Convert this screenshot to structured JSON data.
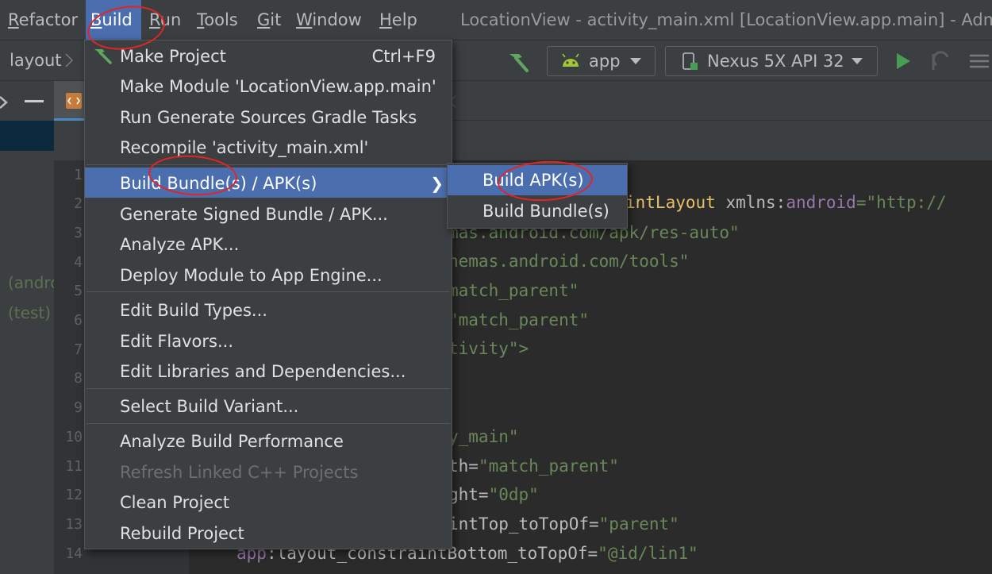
{
  "menubar": {
    "items": [
      {
        "label": "Refactor",
        "key": "R",
        "rest": "efactor"
      },
      {
        "label": "Build",
        "key": "B",
        "rest": "uild"
      },
      {
        "label": "Run",
        "key": "R",
        "rest": "un"
      },
      {
        "label": "Tools",
        "key": "T",
        "rest": "ools"
      },
      {
        "label": "Git",
        "key": "G",
        "rest": "it"
      },
      {
        "label": "Window",
        "key": "W",
        "rest": "indow"
      },
      {
        "label": "Help",
        "key": "H",
        "rest": "elp"
      }
    ],
    "window_title": "LocationView - activity_main.xml [LocationView.app.main] - Admin"
  },
  "toolbar": {
    "breadcrumb": "layout",
    "run_config": "app",
    "device": "Nexus 5X API 32"
  },
  "sidebar": {
    "labels": [
      "(andro",
      "(test)"
    ]
  },
  "editor": {
    "line_numbers": [
      "1",
      "2",
      "3",
      "4",
      "5",
      "6",
      "7",
      "8",
      "9",
      "10",
      "11",
      "12",
      "13",
      "14"
    ],
    "code": {
      "l2_tag": "intLayout",
      "l2_attr": " xmlns:",
      "l2_ns": "android",
      "l2_str": "=\"http://",
      "l3": "mas.android.com/apk/res-auto\"",
      "l4": "nemas.android.com/tools\"",
      "l5": "match_parent\"",
      "l6": "\"match_parent\"",
      "l7": "tivity\">",
      "l10": "y_main\"",
      "l11_attr": "th=",
      "l11_str": "\"match_parent\"",
      "l12_attr": "ght=",
      "l12_str": "\"0dp\"",
      "l13_attr": "intTop_toTopOf=",
      "l13_str": "\"parent\"",
      "l14_ns": "app",
      "l14_attr": ":layout_constraintBottom_toTopOf=",
      "l14_str": "\"@id/lin1\""
    }
  },
  "build_menu": {
    "items": [
      {
        "label": "Make Project",
        "shortcut": "Ctrl+F9"
      },
      {
        "label": "Make Module 'LocationView.app.main'"
      },
      {
        "label": "Run Generate Sources Gradle Tasks"
      },
      {
        "label": "Recompile 'activity_main.xml'"
      },
      {
        "label": "Build Bundle(s) / APK(s)"
      },
      {
        "label": "Generate Signed Bundle / APK..."
      },
      {
        "label": "Analyze APK..."
      },
      {
        "label": "Deploy Module to App Engine..."
      },
      {
        "label": "Edit Build Types..."
      },
      {
        "label": "Edit Flavors..."
      },
      {
        "label": "Edit Libraries and Dependencies..."
      },
      {
        "label": "Select Build Variant..."
      },
      {
        "label": "Analyze Build Performance"
      },
      {
        "label": "Refresh Linked C++ Projects"
      },
      {
        "label": "Clean Project"
      },
      {
        "label": "Rebuild Project"
      }
    ]
  },
  "build_submenu": {
    "items": [
      {
        "label": "Build APK(s)"
      },
      {
        "label": "Build Bundle(s)"
      }
    ]
  },
  "colors": {
    "selection": "#4b6eaf",
    "annotation": "#e32424",
    "android_green": "#a4c639",
    "run_green": "#499c54"
  }
}
